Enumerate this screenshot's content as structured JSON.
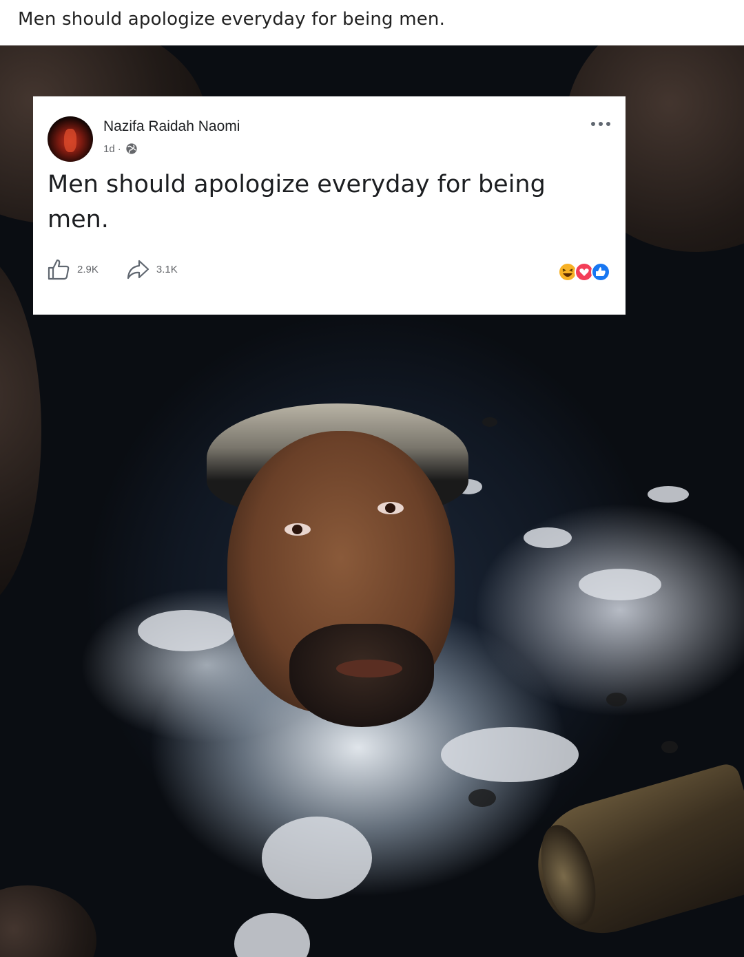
{
  "caption": {
    "text": "Men should apologize everyday for being men."
  },
  "post": {
    "author": "Nazifa Raidah Naomi",
    "time": "1d",
    "separator": "·",
    "text": "Men should apologize everyday for being men.",
    "likes": "2.9K",
    "shares": "3.1K",
    "reactions": [
      "haha-reaction-icon",
      "love-reaction-icon",
      "like-reaction-icon"
    ],
    "colors": {
      "like_blue": "#1877f2",
      "love_red": "#f33e58",
      "haha_yellow": "#f7b125"
    }
  },
  "icons": {
    "more": "more-options-icon",
    "globe": "globe-icon",
    "like": "thumbs-up-icon",
    "share": "share-arrow-icon"
  }
}
